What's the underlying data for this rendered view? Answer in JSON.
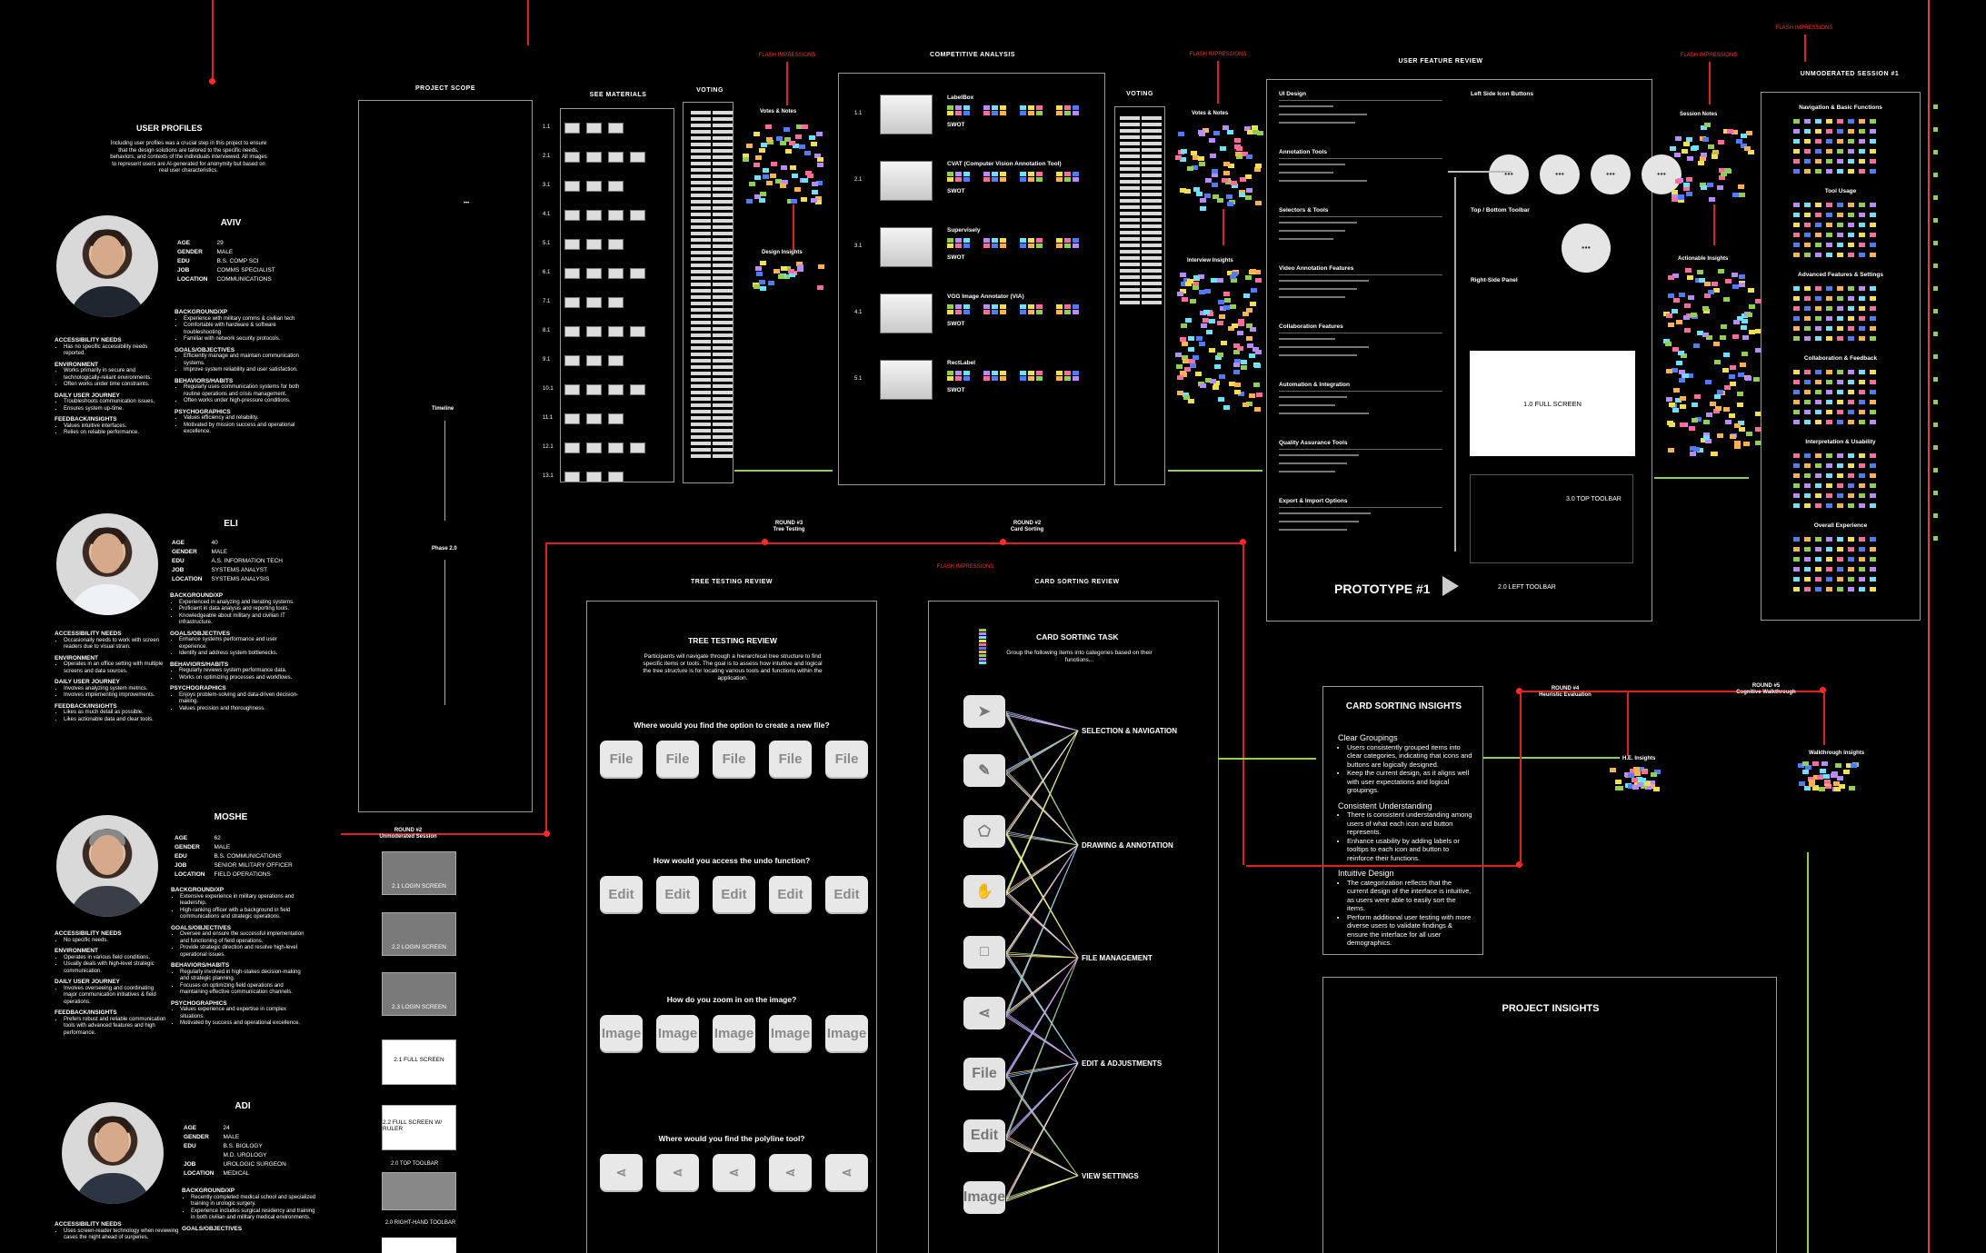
{
  "flash_label": "FLASH IMPRESSIONS",
  "user_profiles": {
    "title": "USER PROFILES",
    "intro": "Including user profiles was a crucial step in this project to ensure that the design solutions are tailored to the specific needs, behaviors, and contexts of the individuals interviewed. All images to represent users are AI-generated for anonymity but based on real user characteristics.",
    "personas": [
      {
        "name": "AVIV",
        "age": "29",
        "gender": "MALE",
        "edu": "B.S. COMP SCI",
        "job": "COMMS SPECIALIST",
        "location": "COMMUNICATIONS",
        "accessibility": [
          "Has no specific accessibility needs reported."
        ],
        "environment": [
          "Works primarily in secure and technologically-reliant environments.",
          "Often works under time constraints."
        ],
        "journey": [
          "Troubleshoots communication issues.",
          "Ensures system up-time."
        ],
        "feedback": [
          "Values intuitive interfaces.",
          "Relies on reliable performance."
        ],
        "background": [
          "Experience with military comms & civilian tech",
          "Comfortable with hardware & software troubleshooting",
          "Familiar with network security protocols."
        ],
        "goals": [
          "Efficiently manage and maintain communication systems.",
          "Improve system reliability and user satisfaction."
        ],
        "behaviors": [
          "Regularly uses communication systems for both routine operations and crisis management.",
          "Often works under high-pressure conditions."
        ],
        "psychographics": [
          "Values efficiency and reliability.",
          "Motivated by mission success and operational excellence."
        ]
      },
      {
        "name": "ELI",
        "age": "40",
        "gender": "MALE",
        "edu": "A.S. INFORMATION TECH",
        "job": "SYSTEMS ANALYST",
        "location": "SYSTEMS ANALYSIS",
        "accessibility": [
          "Occasionally needs to work with screen readers due to visual strain."
        ],
        "environment": [
          "Operates in an office setting with multiple screens and data sources."
        ],
        "journey": [
          "Involves analyzing system metrics.",
          "Involves implementing improvements."
        ],
        "feedback": [
          "Likes as much detail as possible.",
          "Likes actionable data and clear tools."
        ],
        "background": [
          "Experienced in analyzing and iterating systems.",
          "Proficient in data analysis and reporting tools.",
          "Knowledgeable about military and civilian IT infrastructure."
        ],
        "goals": [
          "Enhance systems performance and user experience.",
          "Identify and address system bottlenecks."
        ],
        "behaviors": [
          "Regularly reviews system performance data.",
          "Works on optimizing processes and workflows."
        ],
        "psychographics": [
          "Enjoys problem-solving and data-driven decision-making.",
          "Values precision and thoroughness."
        ]
      },
      {
        "name": "MOSHE",
        "age": "62",
        "gender": "MALE",
        "edu": "B.S. COMMUNICATIONS",
        "job": "SENIOR MILITARY OFFICER",
        "location": "FIELD OPERATIONS",
        "accessibility": [
          "No specific needs."
        ],
        "environment": [
          "Operates in various field conditions.",
          "Usually deals with high-level strategic communication."
        ],
        "journey": [
          "Involves overseeing and coordinating major communication initiatives & field operations."
        ],
        "feedback": [
          "Prefers robust and reliable communication tools with advanced features and high performance."
        ],
        "background": [
          "Extensive experience in military operations and leadership.",
          "High-ranking officer with a background in field communications and strategic operations."
        ],
        "goals": [
          "Oversee and ensure the successful implementation and functioning of field operations.",
          "Provide strategic direction and resolve high-level operational issues."
        ],
        "behaviors": [
          "Regularly involved in high-stakes decision-making and strategic planning.",
          "Focuses on optimizing field operations and maintaining effective communication channels."
        ],
        "psychographics": [
          "Values experience and expertise in complex situations.",
          "Motivated by success and operational excellence."
        ]
      },
      {
        "name": "ADI",
        "age": "24",
        "gender": "MALE",
        "edu": "B.S. BIOLOGY",
        "edu2": "M.D. UROLOGY",
        "job": "UROLOGIC SURGEON",
        "location": "MEDICAL",
        "accessibility": [
          "Uses screen-reader technology when reviewing cases the night ahead of surgeries."
        ],
        "background": [
          "Recently completed medical school and specialized training in urologic surgery.",
          "Experience includes surgical residency and training in both civilian and military medical environments."
        ],
        "goals": []
      }
    ],
    "labels": {
      "age": "AGE",
      "gender": "GENDER",
      "edu": "EDU",
      "job": "JOB",
      "location": "LOCATION",
      "accessibility": "ACCESSIBILITY NEEDS",
      "environment": "ENVIRONMENT",
      "journey": "DAILY USER JOURNEY",
      "feedback": "FEEDBACK/INSIGHTS",
      "background": "BACKGROUND/XP",
      "goals": "GOALS/OBJECTIVES",
      "behaviors": "BEHAVIORS/HABITS",
      "psychographics": "PSYCHOGRAPHICS"
    }
  },
  "project_scope": {
    "title": "PROJECT SCOPE",
    "timeline": "Timeline",
    "phase": "Phase 2.0",
    "ellipsis": "•••"
  },
  "see_materials": {
    "title": "SEE MATERIALS",
    "rows": [
      "1.1",
      "2.1",
      "3.1",
      "4.1",
      "5.1",
      "6.1",
      "7.1",
      "8.1",
      "9.1",
      "10.1",
      "11.1",
      "12.1",
      "13.1"
    ]
  },
  "voting": {
    "title": "VOTING"
  },
  "votes_notes": {
    "title": "Votes & Notes",
    "design_insights": "Design Insights"
  },
  "competitive": {
    "title": "COMPETITIVE ANALYSIS",
    "items": [
      {
        "num": "1.1",
        "name": "LabelBox"
      },
      {
        "num": "2.1",
        "name": "CVAT (Computer Vision Annotation Tool)"
      },
      {
        "num": "3.1",
        "name": "Supervisely"
      },
      {
        "num": "4.1",
        "name": "VGG Image Annotator (VIA)"
      },
      {
        "num": "5.1",
        "name": "RectLabel"
      }
    ],
    "swot": "SWOT"
  },
  "interview_insights": "Interview Insights",
  "user_feature_review": {
    "title": "USER FEATURE REVIEW",
    "sections": [
      "UI Design",
      "Annotation Tools",
      "Selectors & Tools",
      "Video Annotation Features",
      "Collaboration Features",
      "Automation & Integration",
      "Quality Assurance Tools",
      "Export & Import Options"
    ],
    "right_sections": [
      "Left Side Icon Buttons",
      "Top / Bottom Toolbar",
      "Right-Side Panel"
    ],
    "full_screen": "1.0  FULL SCREEN",
    "top_toolbar": "3.0  TOP TOOLBAR",
    "left_toolbar": "2.0  LEFT TOOLBAR",
    "prototype": "PROTOTYPE #1"
  },
  "unmoderated": {
    "title": "UNMODERATED SESSION #1",
    "session_notes": "Session Notes",
    "actionable": "Actionable Insights",
    "sections": [
      "Navigation & Basic Functions",
      "Tool Usage",
      "Advanced Features & Settings",
      "Collaboration & Feedback",
      "Interpretation & Usability",
      "Overall Experience"
    ]
  },
  "round3": {
    "label": "ROUND #3",
    "sub": "Tree Testing"
  },
  "round2": {
    "label": "ROUND #2",
    "sub": "Card Sorting"
  },
  "round2b": {
    "label": "ROUND #2",
    "sub": "Unmoderated Session"
  },
  "round4": {
    "label": "ROUND #4",
    "sub": "Heuristic Evaluation"
  },
  "round5": {
    "label": "ROUND #5",
    "sub": "Cognitive Walkthrough"
  },
  "screens": [
    "2.1 LOGIN SCREEN",
    "2.2 LOGIN SCREEN",
    "2.3 LOGIN SCREEN",
    "2.1  FULL SCREEN",
    "2.2  FULL SCREEN W/ RULER"
  ],
  "toolbar_labels": [
    "2.0 TOP TOOLBAR",
    "2.0 RIGHT-HAND TOOLBAR"
  ],
  "tree_testing": {
    "frame_title": "TREE TESTING REVIEW",
    "title": "TREE TESTING REVIEW",
    "intro": "Participants will navigate through a hierarchical tree structure to find specific items or tools. The goal is to assess how intuitive and logical the tree structure is for locating various tools and functions within the application.",
    "questions": [
      {
        "q": "Where would you find the option to create a new file?",
        "card": "File"
      },
      {
        "q": "How would you access the undo function?",
        "card": "Edit"
      },
      {
        "q": "How do you zoom in on the image?",
        "card": "Image"
      },
      {
        "q": "Where would you find the polyline tool?",
        "card": "share-icon"
      }
    ]
  },
  "card_sorting": {
    "frame_title": "CARD SORTING REVIEW",
    "title": "CARD SORTING TASK",
    "intro": "Group the following items into categories based on their functions...",
    "categories": [
      "SELECTION & NAVIGATION",
      "DRAWING & ANNOTATION",
      "FILE MANAGEMENT",
      "EDIT & ADJUSTMENTS",
      "VIEW SETTINGS"
    ],
    "cards": [
      "cursor-icon",
      "pencil-icon",
      "tag-icon",
      "hand-icon",
      "square-icon",
      "share-icon",
      "File",
      "Edit",
      "Image"
    ],
    "line_colors": [
      "#f4e04d",
      "#b98bff",
      "#6be3ff",
      "#ff8bd1",
      "#8fd14f",
      "#ffffff"
    ]
  },
  "cs_insights": {
    "title": "CARD SORTING INSIGHTS",
    "sections": [
      {
        "h": "Clear Groupings",
        "items": [
          "Users consistently grouped items into clear categories, indicating that icons and buttons are logically designed.",
          "Keep the current design, as it aligns well with user expectations and logical groupings."
        ]
      },
      {
        "h": "Consistent Understanding",
        "items": [
          "There is consistent understanding among users of what each icon and button represents.",
          "Enhance usability by adding labels or tooltips to each icon and button to reinforce their functions."
        ]
      },
      {
        "h": "Intuitive Design",
        "items": [
          "The categorization reflects that the current design of the interface is intuitive, as users were able to easily sort the items.",
          "Perform additional user testing with more diverse users to validate findings & ensure the interface for all user demographics."
        ]
      }
    ]
  },
  "project_insights": "PROJECT INSIGHTS",
  "he_insights": "H.E. Insights",
  "walkthrough_insights": "Walkthrough Insights",
  "sticky_colors": [
    "#8fd14f",
    "#b98bff",
    "#6be3ff",
    "#f4e04d",
    "#ff6b9a",
    "#4f7bff",
    "#ffb14f"
  ]
}
